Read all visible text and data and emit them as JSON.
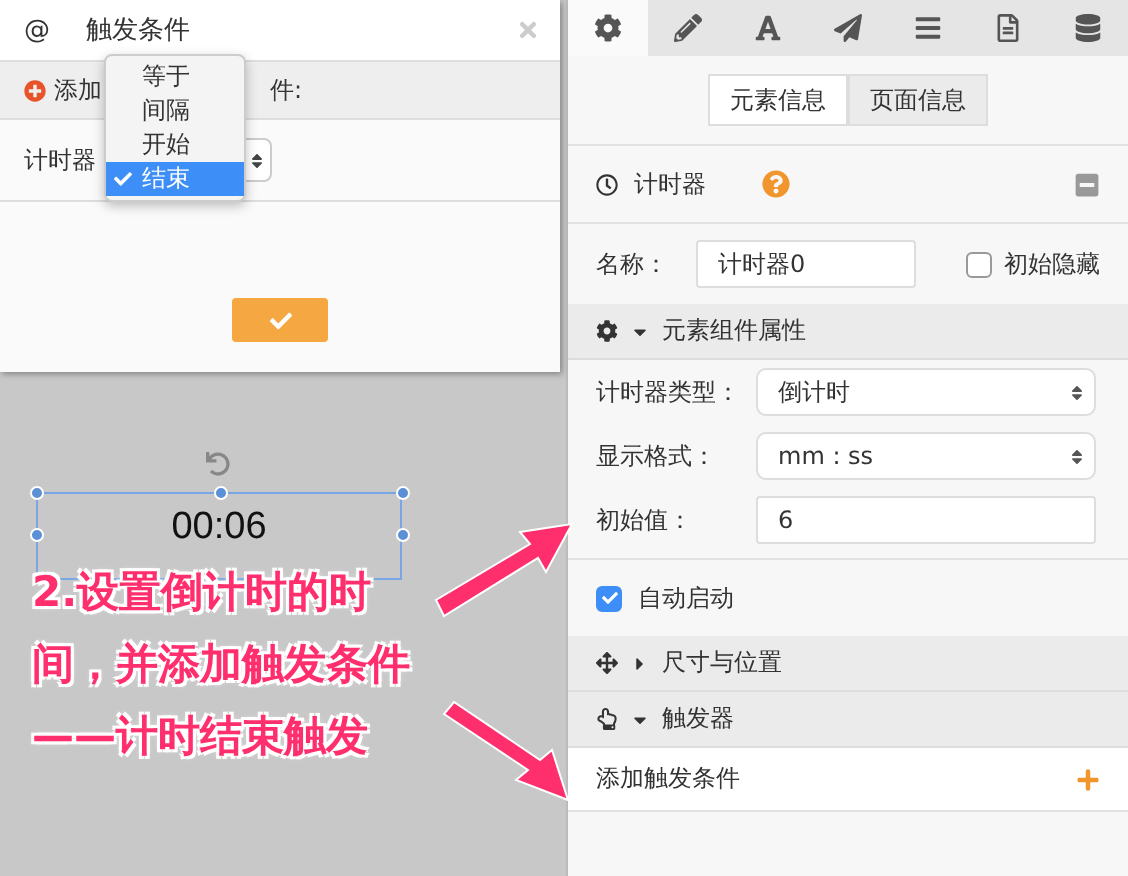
{
  "dialog": {
    "prefix": "@",
    "title": "触发条件",
    "add_head": "添加",
    "add_tail": "件:",
    "row_label": "计时器"
  },
  "dropdown": {
    "options": [
      {
        "label": "等于",
        "selected": false
      },
      {
        "label": "间隔",
        "selected": false
      },
      {
        "label": "开始",
        "selected": false
      },
      {
        "label": "结束",
        "selected": true
      }
    ]
  },
  "canvas": {
    "timer_text": "00:06"
  },
  "annotation": {
    "lines": [
      "2.设置倒计时的时",
      "间，并添加触发条件",
      "——计时结束触发"
    ]
  },
  "panel": {
    "tabs": [
      {
        "kind": "gear",
        "selected": true
      },
      {
        "kind": "pencil",
        "selected": false
      },
      {
        "kind": "font",
        "selected": false
      },
      {
        "kind": "plane",
        "selected": false
      },
      {
        "kind": "list",
        "selected": false
      },
      {
        "kind": "file",
        "selected": false
      },
      {
        "kind": "database",
        "selected": false
      }
    ],
    "info_tabs": [
      {
        "label": "元素信息",
        "selected": true
      },
      {
        "label": "页面信息",
        "selected": false
      }
    ],
    "component_title": "计时器",
    "name_field": {
      "label": "名称：",
      "value": "计时器0"
    },
    "hidden_checkbox": {
      "label": "初始隐藏",
      "checked": false
    },
    "props_section": {
      "title": "元素组件属性",
      "expanded": true
    },
    "fields": [
      {
        "kind": "select",
        "label": "计时器类型：",
        "value": "倒计时"
      },
      {
        "kind": "select",
        "label": "显示格式：",
        "value": "mm : ss"
      },
      {
        "kind": "input",
        "label": "初始值：",
        "value": "6"
      }
    ],
    "auto_start": {
      "label": "自动启动",
      "checked": true
    },
    "size_section": {
      "title": "尺寸与位置",
      "expanded": false
    },
    "trigger_section": {
      "title": "触发器",
      "expanded": true
    },
    "add_trigger": {
      "label": "添加触发条件"
    }
  }
}
